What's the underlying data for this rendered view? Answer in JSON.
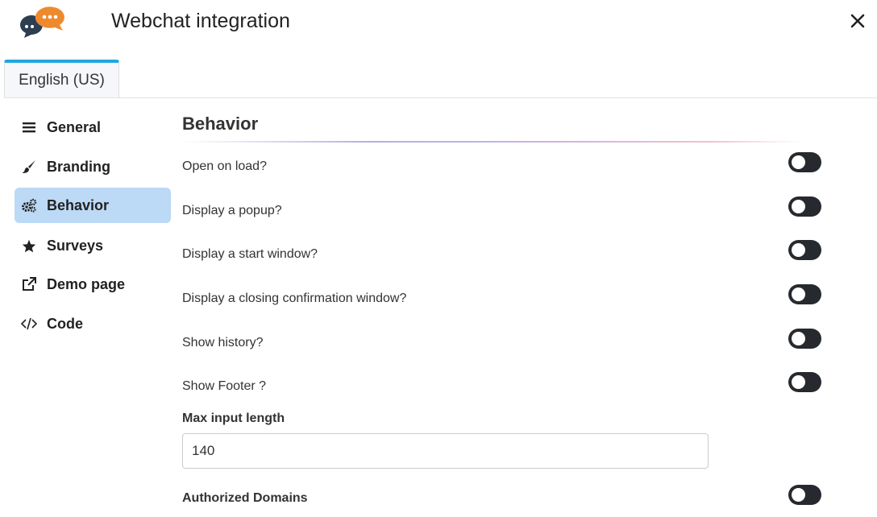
{
  "app": {
    "title": "Webchat integration"
  },
  "tabs": [
    {
      "label": "English (US)",
      "active": true
    }
  ],
  "sidebar": {
    "items": [
      {
        "label": "General",
        "icon": "bars-icon",
        "active": false
      },
      {
        "label": "Branding",
        "icon": "paintbrush-icon",
        "active": false
      },
      {
        "label": "Behavior",
        "icon": "gears-icon",
        "active": true
      },
      {
        "label": "Surveys",
        "icon": "star-icon",
        "active": false
      },
      {
        "label": "Demo page",
        "icon": "external-link-icon",
        "active": false
      },
      {
        "label": "Code",
        "icon": "code-icon",
        "active": false
      }
    ]
  },
  "main": {
    "section_title": "Behavior",
    "toggles": [
      {
        "label": "Open on load?",
        "on": false
      },
      {
        "label": "Display a popup?",
        "on": false
      },
      {
        "label": "Display a start window?",
        "on": false
      },
      {
        "label": "Display a closing confirmation window?",
        "on": false
      },
      {
        "label": "Show history?",
        "on": false
      },
      {
        "label": "Show Footer ?",
        "on": false
      }
    ],
    "max_input_length": {
      "label": "Max input length",
      "value": "140"
    },
    "authorized_domains": {
      "label": "Authorized Domains",
      "on": false
    }
  },
  "colors": {
    "tab_accent": "#1ea7e1",
    "active_nav_bg": "#bcd9f6",
    "toggle_off": "#262a2e",
    "logo_orange": "#ee8a2e",
    "logo_navy": "#2d3e50"
  }
}
